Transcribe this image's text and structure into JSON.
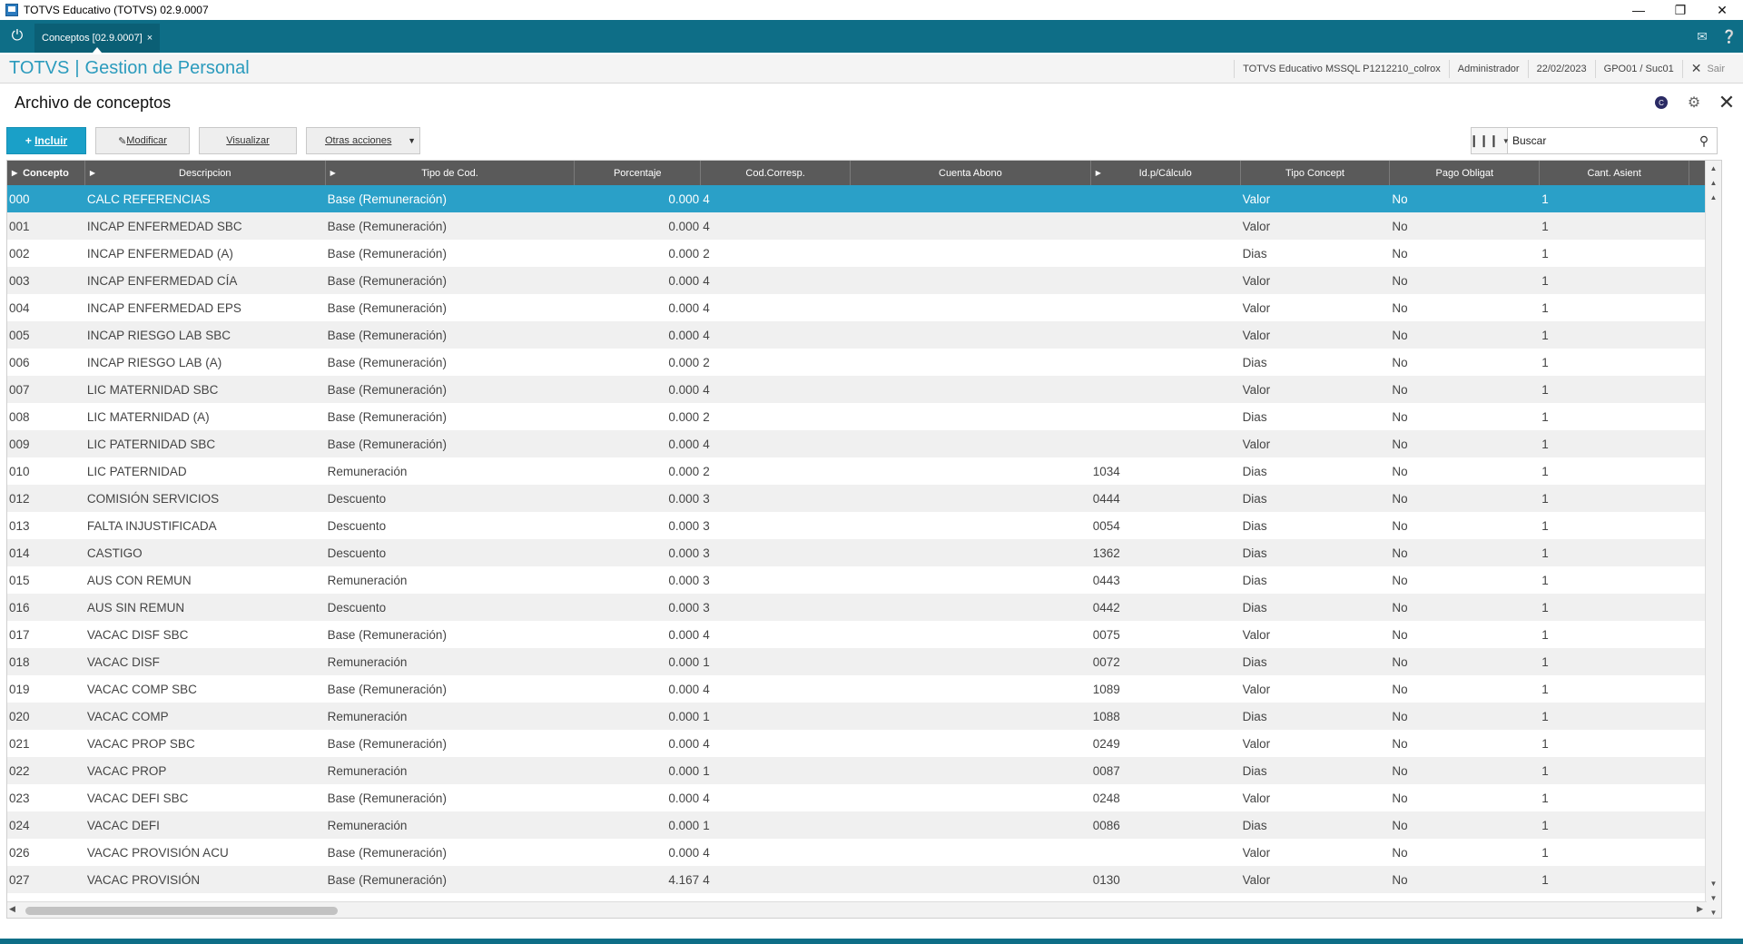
{
  "window": {
    "title": "TOTVS Educativo (TOTVS) 02.9.0007"
  },
  "tabbar": {
    "active_tab": "Conceptos [02.9.0007]",
    "tab_close": "×"
  },
  "brand": {
    "prefix": "TOTVS",
    "separator": "|",
    "module": "Gestion de Personal"
  },
  "session": {
    "environment": "TOTVS Educativo MSSQL P1212210_colrox",
    "user": "Administrador",
    "date": "22/02/2023",
    "branch": "GPO01 / Suc01",
    "logout_label": "Sair"
  },
  "page": {
    "title": "Archivo de conceptos"
  },
  "toolbar": {
    "include_label": "Incluir",
    "modify_label": "Modificar",
    "view_label": "Visualizar",
    "more_label": "Otras acciones"
  },
  "search": {
    "placeholder": "Buscar"
  },
  "grid": {
    "columns": [
      {
        "label": "Concepto",
        "sortable": true,
        "bold": true
      },
      {
        "label": "Descripcion",
        "sortable": true
      },
      {
        "label": "Tipo de Cod.",
        "sortable": true
      },
      {
        "label": "Porcentaje",
        "sortable": false
      },
      {
        "label": "Cod.Corresp.",
        "sortable": false
      },
      {
        "label": "Cuenta Abono",
        "sortable": false
      },
      {
        "label": "Id.p/Cálculo",
        "sortable": true
      },
      {
        "label": "Tipo Concept",
        "sortable": false
      },
      {
        "label": "Pago Obligat",
        "sortable": false
      },
      {
        "label": "Cant. Asient",
        "sortable": false
      },
      {
        "label": "",
        "sortable": false
      }
    ],
    "selected_row": 0,
    "rows": [
      [
        "000",
        "CALC REFERENCIAS",
        "Base (Remuneración)",
        "0.000",
        "4",
        "",
        "",
        "Valor",
        "No",
        "1"
      ],
      [
        "001",
        "INCAP ENFERMEDAD SBC",
        "Base (Remuneración)",
        "0.000",
        "4",
        "",
        "",
        "Valor",
        "No",
        "1"
      ],
      [
        "002",
        "INCAP ENFERMEDAD (A)",
        "Base (Remuneración)",
        "0.000",
        "2",
        "",
        "",
        "Dias",
        "No",
        "1"
      ],
      [
        "003",
        "INCAP ENFERMEDAD CÍA",
        "Base (Remuneración)",
        "0.000",
        "4",
        "",
        "",
        "Valor",
        "No",
        "1"
      ],
      [
        "004",
        "INCAP ENFERMEDAD EPS",
        "Base (Remuneración)",
        "0.000",
        "4",
        "",
        "",
        "Valor",
        "No",
        "1"
      ],
      [
        "005",
        "INCAP RIESGO LAB SBC",
        "Base (Remuneración)",
        "0.000",
        "4",
        "",
        "",
        "Valor",
        "No",
        "1"
      ],
      [
        "006",
        "INCAP RIESGO LAB (A)",
        "Base (Remuneración)",
        "0.000",
        "2",
        "",
        "",
        "Dias",
        "No",
        "1"
      ],
      [
        "007",
        "LIC MATERNIDAD SBC",
        "Base (Remuneración)",
        "0.000",
        "4",
        "",
        "",
        "Valor",
        "No",
        "1"
      ],
      [
        "008",
        "LIC MATERNIDAD (A)",
        "Base (Remuneración)",
        "0.000",
        "2",
        "",
        "",
        "Dias",
        "No",
        "1"
      ],
      [
        "009",
        "LIC PATERNIDAD SBC",
        "Base (Remuneración)",
        "0.000",
        "4",
        "",
        "",
        "Valor",
        "No",
        "1"
      ],
      [
        "010",
        "LIC PATERNIDAD",
        "Remuneración",
        "0.000",
        "2",
        "",
        "1034",
        "Dias",
        "No",
        "1"
      ],
      [
        "012",
        "COMISIÓN SERVICIOS",
        "Descuento",
        "0.000",
        "3",
        "",
        "0444",
        "Dias",
        "No",
        "1"
      ],
      [
        "013",
        "FALTA INJUSTIFICADA",
        "Descuento",
        "0.000",
        "3",
        "",
        "0054",
        "Dias",
        "No",
        "1"
      ],
      [
        "014",
        "CASTIGO",
        "Descuento",
        "0.000",
        "3",
        "",
        "1362",
        "Dias",
        "No",
        "1"
      ],
      [
        "015",
        "AUS CON REMUN",
        "Remuneración",
        "0.000",
        "3",
        "",
        "0443",
        "Dias",
        "No",
        "1"
      ],
      [
        "016",
        "AUS SIN REMUN",
        "Descuento",
        "0.000",
        "3",
        "",
        "0442",
        "Dias",
        "No",
        "1"
      ],
      [
        "017",
        "VACAC DISF SBC",
        "Base (Remuneración)",
        "0.000",
        "4",
        "",
        "0075",
        "Valor",
        "No",
        "1"
      ],
      [
        "018",
        "VACAC DISF",
        "Remuneración",
        "0.000",
        "1",
        "",
        "0072",
        "Dias",
        "No",
        "1"
      ],
      [
        "019",
        "VACAC COMP SBC",
        "Base (Remuneración)",
        "0.000",
        "4",
        "",
        "1089",
        "Valor",
        "No",
        "1"
      ],
      [
        "020",
        "VACAC COMP",
        "Remuneración",
        "0.000",
        "1",
        "",
        "1088",
        "Dias",
        "No",
        "1"
      ],
      [
        "021",
        "VACAC PROP SBC",
        "Base (Remuneración)",
        "0.000",
        "4",
        "",
        "0249",
        "Valor",
        "No",
        "1"
      ],
      [
        "022",
        "VACAC PROP",
        "Remuneración",
        "0.000",
        "1",
        "",
        "0087",
        "Dias",
        "No",
        "1"
      ],
      [
        "023",
        "VACAC DEFI SBC",
        "Base (Remuneración)",
        "0.000",
        "4",
        "",
        "0248",
        "Valor",
        "No",
        "1"
      ],
      [
        "024",
        "VACAC DEFI",
        "Remuneración",
        "0.000",
        "1",
        "",
        "0086",
        "Dias",
        "No",
        "1"
      ],
      [
        "026",
        "VACAC PROVISIÓN ACU",
        "Base (Remuneración)",
        "0.000",
        "4",
        "",
        "",
        "Valor",
        "No",
        "1"
      ],
      [
        "027",
        "VACAC PROVISIÓN",
        "Base (Remuneración)",
        "4.167",
        "4",
        "",
        "0130",
        "Valor",
        "No",
        "1"
      ]
    ]
  },
  "colors": {
    "tabbar": "#0e6e87",
    "brand_text": "#2b9bbd",
    "primary_button": "#1aa0c8",
    "selected_row": "#2aa0c8",
    "grid_header": "#5a5a5a"
  },
  "icons": {
    "app": "totvs-app-icon",
    "home": "power-icon",
    "mail": "mail-icon",
    "help": "help-icon",
    "theme": "theme-dot-icon",
    "settings": "gear-icon",
    "close": "close-icon",
    "columns": "columns-icon",
    "search": "search-icon"
  }
}
